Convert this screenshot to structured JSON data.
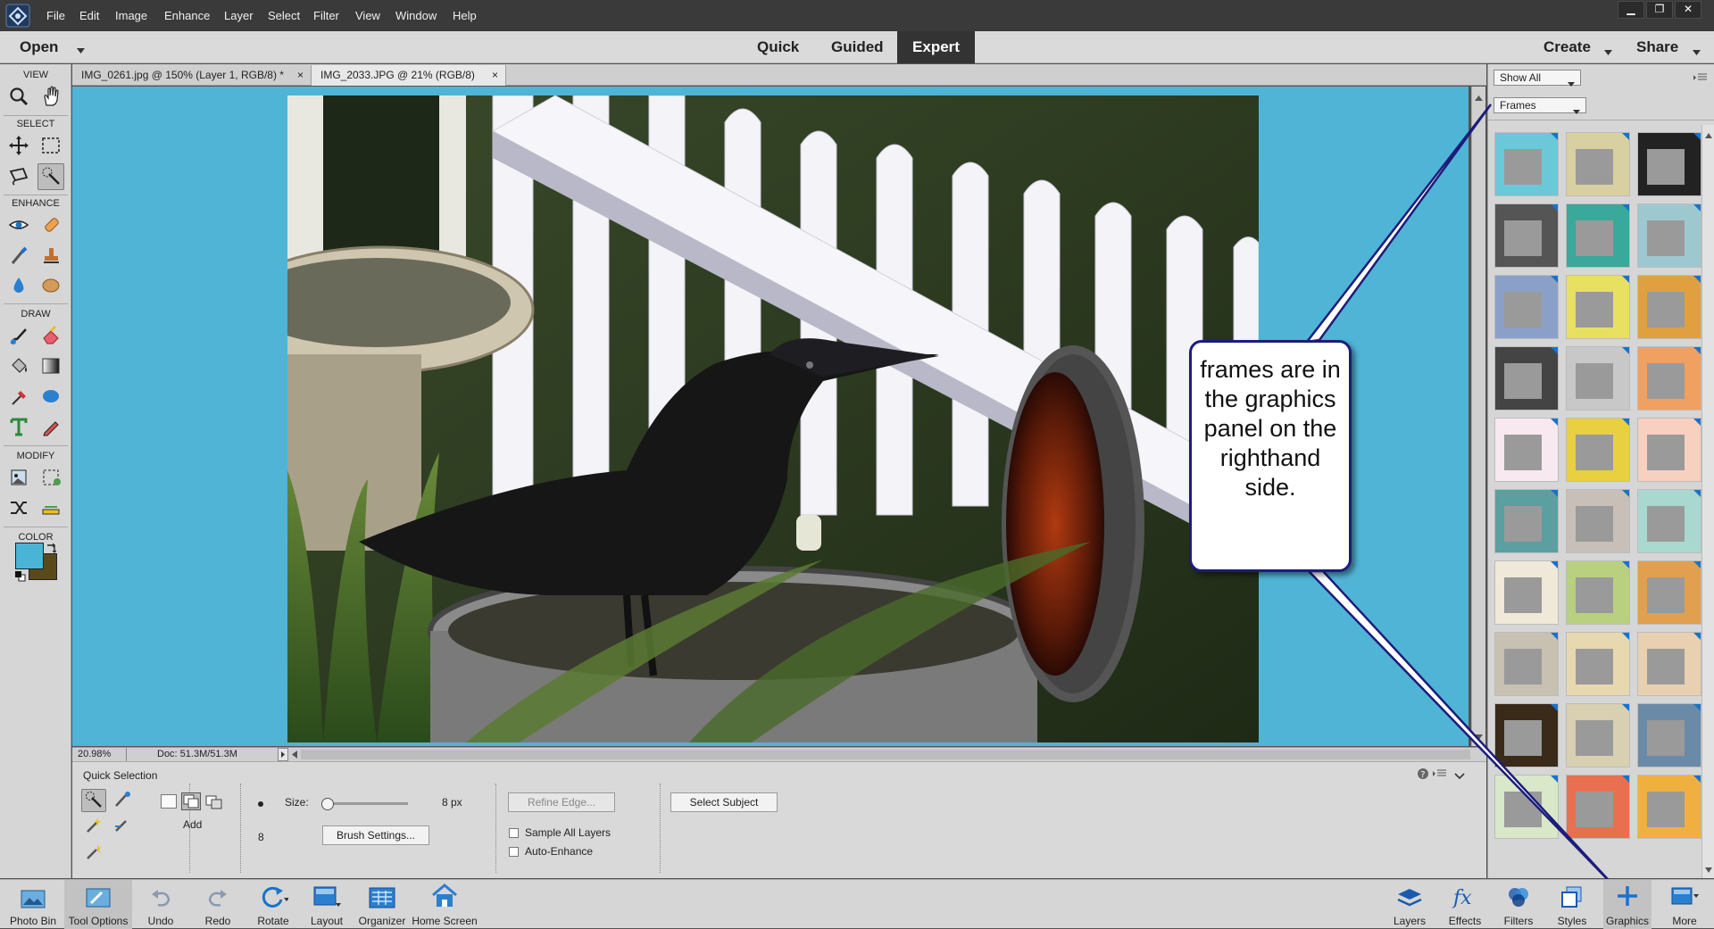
{
  "menu": [
    "File",
    "Edit",
    "Image",
    "Enhance",
    "Layer",
    "Select",
    "Filter",
    "View",
    "Window",
    "Help"
  ],
  "window_controls": {
    "minimize": "▁",
    "restore": "❐",
    "close": "✕"
  },
  "topbar": {
    "open": "Open",
    "modes": [
      "Quick",
      "Guided",
      "Expert"
    ],
    "active_mode": "Expert",
    "create": "Create",
    "share": "Share"
  },
  "toolbox": {
    "sections": [
      "VIEW",
      "SELECT",
      "ENHANCE",
      "DRAW",
      "MODIFY",
      "COLOR"
    ],
    "fg_color": "#4ab4d6",
    "bg_color": "#5a4a1a"
  },
  "tabs": [
    {
      "label": "IMG_0261.jpg @ 150% (Layer 1, RGB/8) *",
      "close": "×"
    },
    {
      "label": "IMG_2033.JPG @ 21% (RGB/8)",
      "close": "×",
      "active": true
    }
  ],
  "status": {
    "zoom": "20.98%",
    "doc": "Doc: 51.3M/51.3M"
  },
  "tool_options": {
    "title": "Quick Selection",
    "mode_label": "Add",
    "size_label": "Size:",
    "size_value": "8 px",
    "size_fraction": 0.05,
    "brush_number": "8",
    "brush_settings": "Brush Settings...",
    "refine_edge": "Refine Edge...",
    "sample_all_layers": "Sample All Layers",
    "auto_enhance": "Auto-Enhance",
    "select_subject": "Select Subject"
  },
  "right_panel": {
    "filter1": "Show All",
    "filter2": "Frames"
  },
  "callout": {
    "text": "frames are in the graphics panel on the righthand side."
  },
  "bottom_left": [
    "Photo Bin",
    "Tool Options",
    "Undo",
    "Redo",
    "Rotate",
    "Layout",
    "Organizer",
    "Home Screen"
  ],
  "bottom_right": [
    "Layers",
    "Effects",
    "Filters",
    "Styles",
    "Graphics",
    "More"
  ],
  "colors": {
    "canvas": "#50b4d6",
    "accent": "#1a72c9",
    "callout_border": "#1c1c7c"
  }
}
